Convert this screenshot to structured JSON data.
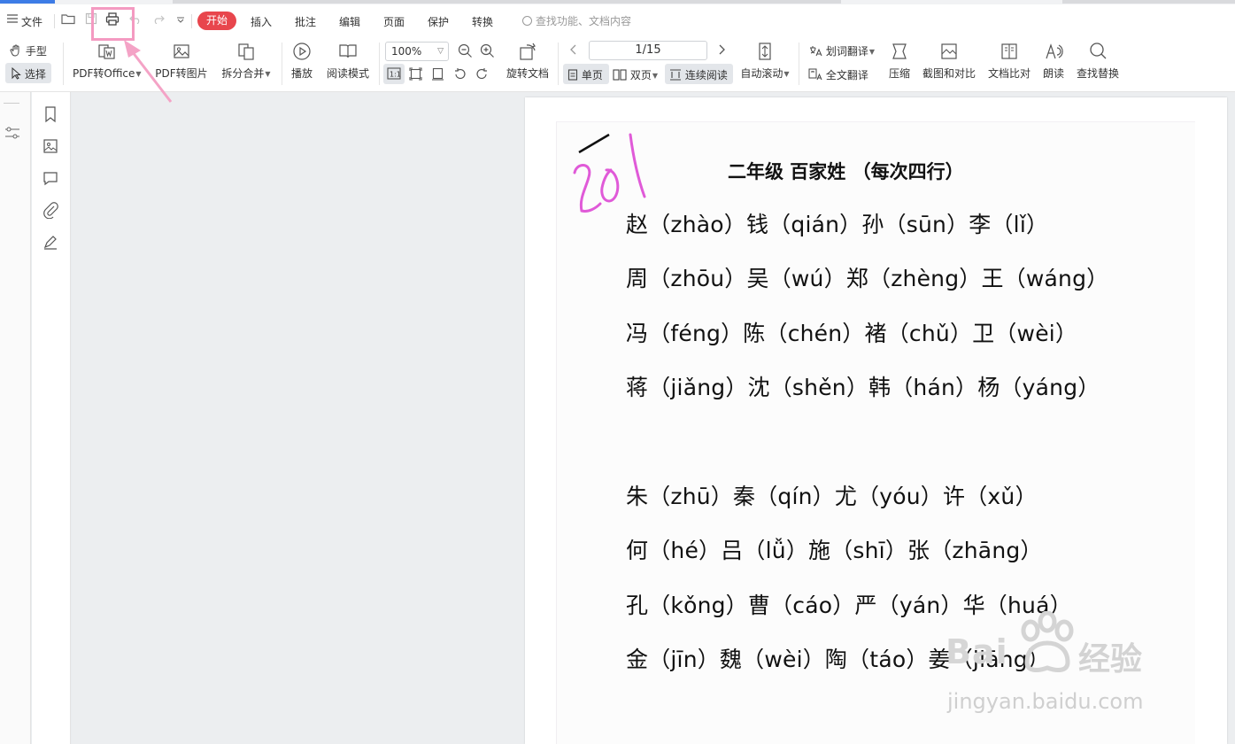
{
  "menubar": {
    "file_label": "文件",
    "tabs": [
      "开始",
      "插入",
      "批注",
      "编辑",
      "页面",
      "保护",
      "转换"
    ],
    "search_placeholder": "查找功能、文档内容"
  },
  "toolbar": {
    "hand_label": "手型",
    "select_label": "选择",
    "pdf_to_office": "PDF转Office",
    "pdf_to_image": "PDF转图片",
    "split_merge": "拆分合并",
    "play": "播放",
    "read_mode": "阅读模式",
    "zoom": "100%",
    "rotate_doc": "旋转文档",
    "page_indicator": "1/15",
    "single_page": "单页",
    "double_page": "双页",
    "continuous": "连续阅读",
    "auto_scroll": "自动滚动",
    "word_translate": "划词翻译",
    "full_translate": "全文翻译",
    "compress": "压缩",
    "screenshot_compare": "截图和对比",
    "doc_compare": "文档比对",
    "read_aloud": "朗读",
    "find_replace": "查找替换"
  },
  "document": {
    "title": "二年级   百家姓  （每次四行）",
    "handwriting": "201",
    "lines": [
      "赵（zhào）钱（qián）孙（sūn）李（lǐ）",
      "周（zhōu）吴（wú）郑（zhèng）王（wáng）",
      "冯（féng）陈（chén）褚（chǔ）卫（wèi）",
      "蒋（jiǎng）沈（shěn）韩（hán）杨（yáng）",
      "朱（zhū）秦（qín）尤（yóu）许（xǔ）",
      "何（hé）吕（lǚ）施（shī）张（zhāng）",
      "孔（kǒng）曹（cáo）严（yán）华（huá）",
      "金（jīn）魏（wèi）陶（táo）姜（jiāng）"
    ]
  },
  "watermark": {
    "brand": "Bai",
    "brand_cn": "经验",
    "url": "jingyan.baidu.com"
  },
  "colors": {
    "active_tab": "#e8464d",
    "highlight": "#f49ac1"
  }
}
